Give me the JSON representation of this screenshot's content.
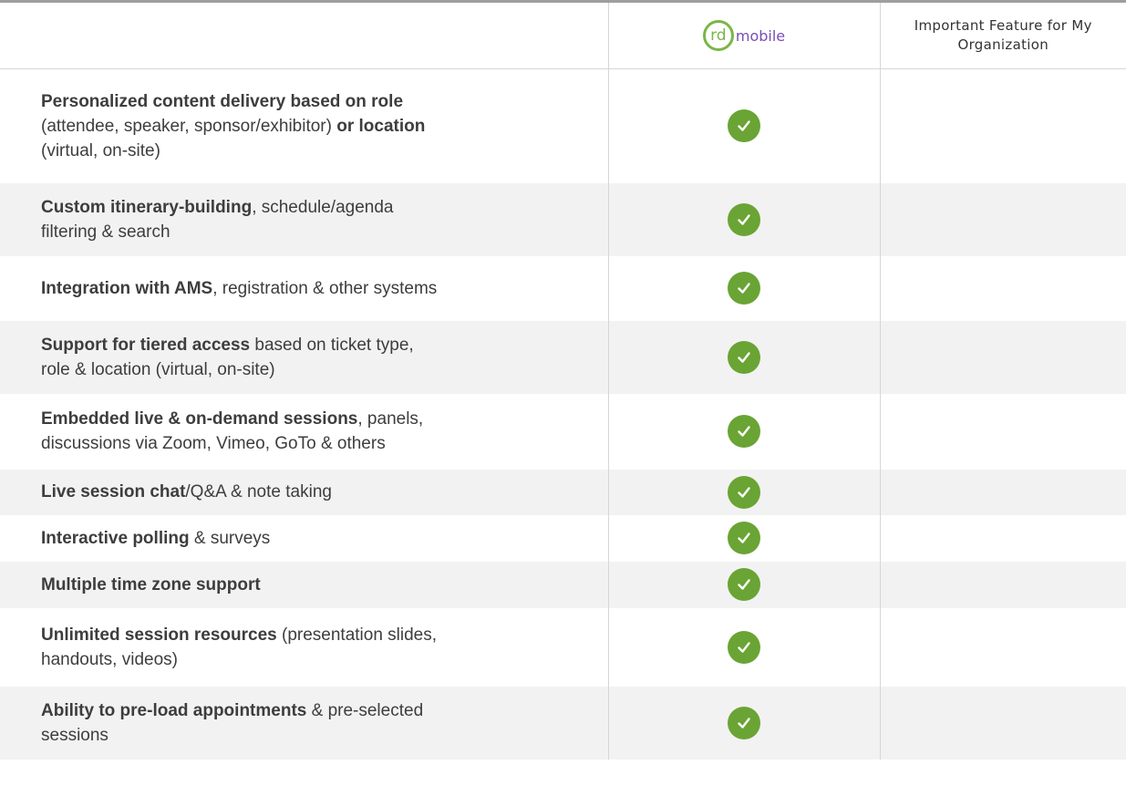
{
  "header": {
    "logo": {
      "circle_text": "rd",
      "word": "mobile",
      "colors": {
        "circle": "#7ab648",
        "word": "#7a4db5"
      }
    },
    "column3_title": "Important Feature for My Organization"
  },
  "colors": {
    "check_fill": "#6aa434",
    "row_shade": "#f2f2f2",
    "border": "#d6d6d6"
  },
  "rows": [
    {
      "parts": [
        {
          "text": "Personalized content delivery based on role",
          "bold": true
        },
        {
          "text": "(attendee, speaker, sponsor/exhibitor) ",
          "bold": false
        },
        {
          "text": "or location",
          "bold": true
        },
        {
          "text": "(virtual, on-site)",
          "bold": false
        }
      ],
      "check": "check-icon"
    },
    {
      "parts": [
        {
          "text": "Custom itinerary-building",
          "bold": true
        },
        {
          "text": ", schedule/agenda",
          "bold": false
        },
        {
          "text": "filtering & search",
          "bold": false
        }
      ],
      "check": "check-icon"
    },
    {
      "parts": [
        {
          "text": "Integration with AMS",
          "bold": true
        },
        {
          "text": ", registration & other systems",
          "bold": false
        }
      ],
      "check": "check-icon"
    },
    {
      "parts": [
        {
          "text": "Support for tiered access",
          "bold": true
        },
        {
          "text": " based on ticket type,",
          "bold": false
        },
        {
          "text": "role & location (virtual, on-site)",
          "bold": false
        }
      ],
      "check": "check-icon"
    },
    {
      "parts": [
        {
          "text": "Embedded live & on-demand sessions",
          "bold": true
        },
        {
          "text": ", panels,",
          "bold": false
        },
        {
          "text": "discussions via Zoom, Vimeo, GoTo & others",
          "bold": false
        }
      ],
      "check": "check-icon"
    },
    {
      "parts": [
        {
          "text": "Live session chat",
          "bold": true
        },
        {
          "text": "/Q&A & note taking",
          "bold": false
        }
      ],
      "check": "check-icon"
    },
    {
      "parts": [
        {
          "text": "Interactive polling",
          "bold": true
        },
        {
          "text": " & surveys",
          "bold": false
        }
      ],
      "check": "check-icon"
    },
    {
      "parts": [
        {
          "text": "Multiple time zone support",
          "bold": true
        }
      ],
      "check": "check-icon"
    },
    {
      "parts": [
        {
          "text": "Unlimited session resources",
          "bold": true
        },
        {
          "text": " (presentation slides,",
          "bold": false
        },
        {
          "text": "handouts, videos)",
          "bold": false
        }
      ],
      "check": "check-icon"
    },
    {
      "parts": [
        {
          "text": "Ability to pre-load appointments",
          "bold": true
        },
        {
          "text": " & pre-selected",
          "bold": false
        },
        {
          "text": "sessions",
          "bold": false
        }
      ],
      "check": "check-icon"
    }
  ]
}
